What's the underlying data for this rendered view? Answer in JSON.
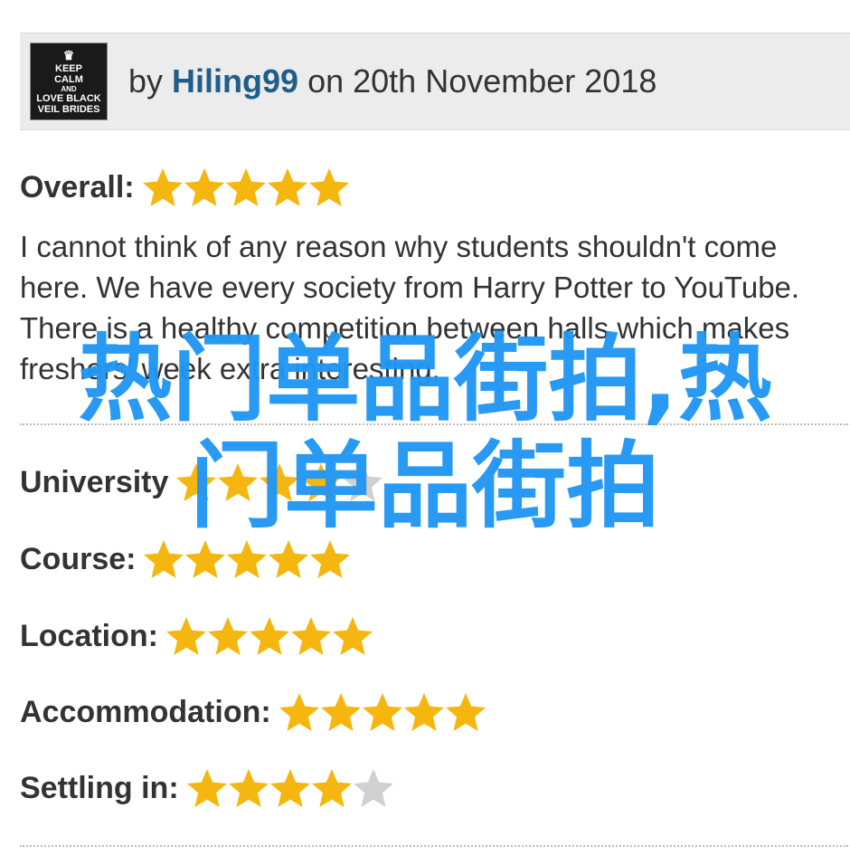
{
  "header": {
    "avatar_lines": [
      "KEEP",
      "CALM",
      "AND",
      "LOVE BLACK",
      "VEIL BRIDES"
    ],
    "by_prefix": "by",
    "username": "Hiling99",
    "date_text": "on 20th November 2018"
  },
  "overall": {
    "label": "Overall:",
    "rating": 5,
    "max": 5
  },
  "review": {
    "text": "I cannot think of any reason why students shouldn't come here. We have every society from Harry Potter to YouTube. There is a healthy competition between halls which makes freshers' week extra interesting."
  },
  "ratings": [
    {
      "key": "university",
      "label": "University",
      "rating": 4,
      "max": 5
    },
    {
      "key": "course",
      "label": "Course:",
      "rating": 5,
      "max": 5
    },
    {
      "key": "location",
      "label": "Location:",
      "rating": 5,
      "max": 5
    },
    {
      "key": "accommodation",
      "label": "Accommodation:",
      "rating": 5,
      "max": 5
    },
    {
      "key": "settling",
      "label": "Settling in:",
      "rating": 4,
      "max": 5
    }
  ],
  "watermark": {
    "line1": "热门单品街拍,热",
    "line2": "门单品街拍"
  },
  "colors": {
    "star_filled": "#f5b70f",
    "star_empty": "#d0d0d0",
    "username": "#1f5d8a",
    "watermark": "#2196f3",
    "header_bg": "#ececec"
  },
  "icons": {
    "star": "star-icon",
    "avatar": "avatar-image"
  }
}
